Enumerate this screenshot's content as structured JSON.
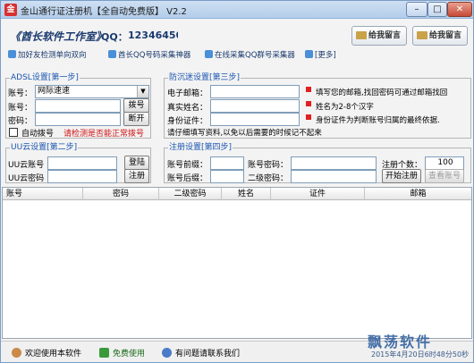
{
  "window": {
    "title": "金山通行证注册机【全自动免费版】 V2.2",
    "app_icon_glyph": "金",
    "controls": {
      "minimize": "–",
      "maximize": "□",
      "close": "✕"
    }
  },
  "header": {
    "studio": "《酋长软件工作室》",
    "qq_label": "QQ：",
    "qq_number": "12346450",
    "message_button_1": "给我留言",
    "message_button_2": "给我留言"
  },
  "links": [
    "加好友检测单向双向",
    "酋长QQ号码采集神器",
    "在线采集QQ群号采集器",
    "[更多]"
  ],
  "adsl": {
    "title": "ADSL设置[第一步]",
    "account_label": "账号：",
    "account_value": "网际速速",
    "number_label": "账号：",
    "password_label": "密码：",
    "dial_button": "拨号",
    "disconnect_button": "断开",
    "auto_dial_label": "自动拨号",
    "warning": "请检测是否能正常拨号"
  },
  "anti": {
    "title": "防沉迷设置[第三步]",
    "email_label": "电子邮箱：",
    "realname_label": "真实姓名：",
    "idcard_label": "身份证件：",
    "note_email": "填写您的邮箱,找回密码可通过邮箱找回",
    "note_name": "姓名为2-8个汉字",
    "note_id": "身份证件为判断账号归属的最终依据.",
    "footer_note": "请仔细填写资料,以免以后需要的时候记不起来"
  },
  "uu": {
    "title": "UU云设置[第二步]",
    "account_label": "UU云账号",
    "password_label": "UU云密码",
    "login_button": "登陆",
    "register_button": "注册"
  },
  "register": {
    "title": "注册设置[第四步]",
    "prefix_label": "账号前缀：",
    "suffix_label": "账号后缀：",
    "password_label": "账号密码：",
    "password2_label": "二级密码：",
    "count_label": "注册个数：",
    "count_value": "100",
    "start_button": "开始注册",
    "view_button": "查看账号"
  },
  "table": {
    "columns": [
      "账号",
      "密码",
      "二级密码",
      "姓名",
      "证件",
      "邮箱"
    ]
  },
  "status": {
    "welcome": "欢迎使用本软件",
    "free": "免费使用",
    "contact": "有问题请联系我们",
    "watermark": "飘荡软件",
    "datetime": "2015年4月20日6时48分50秒"
  }
}
